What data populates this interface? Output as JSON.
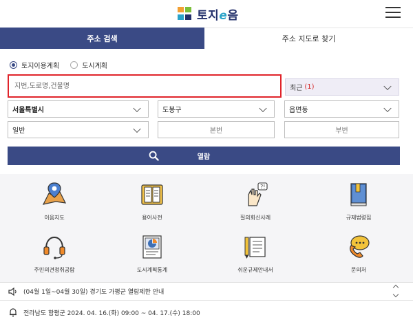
{
  "header": {
    "logo_text": "토지e음",
    "menu_icon": "hamburger-menu-icon"
  },
  "tabs": [
    {
      "label": "주소 검색",
      "active": true
    },
    {
      "label": "주소 지도로 찾기",
      "active": false
    }
  ],
  "search": {
    "radios": [
      {
        "label": "토지이용계획",
        "checked": true
      },
      {
        "label": "도시계획",
        "checked": false
      }
    ],
    "placeholder": "지번,도로명,건물명",
    "value": "",
    "recent_label": "최근",
    "recent_count": "(1)",
    "selects": {
      "sido": "서울특별시",
      "sigungu": "도봉구",
      "eupmyeondong": "읍면동",
      "type": "일반"
    },
    "bonbun_placeholder": "본번",
    "bubun_placeholder": "부번",
    "view_button": "열람"
  },
  "menu": [
    {
      "label": "이음지도",
      "icon": "map-pin-icon"
    },
    {
      "label": "용어사전",
      "icon": "book-icon"
    },
    {
      "label": "질의회신사례",
      "icon": "question-hand-icon"
    },
    {
      "label": "규제법령집",
      "icon": "law-book-icon"
    },
    {
      "label": "주민의견청취공람",
      "icon": "headset-icon"
    },
    {
      "label": "도시계획통계",
      "icon": "statistics-icon"
    },
    {
      "label": "쉬운규제안내서",
      "icon": "guide-pencil-icon"
    },
    {
      "label": "문의처",
      "icon": "phone-chat-icon"
    }
  ],
  "notices": [
    {
      "text": "(04월 1일~04월 30일) 경기도 가평군 열람제한 안내",
      "icon": "speaker-icon"
    },
    {
      "text": "전라남도 함평군 2024. 04. 16.(화) 09:00 ~ 04. 17.(수) 18:00",
      "icon": "bell-icon"
    }
  ],
  "colors": {
    "primary": "#3a4a85",
    "highlight_border": "#e0232a",
    "recent_bg": "#efedf6",
    "recent_count": "#d62b2b",
    "grid_bg": "#f5f5f7"
  }
}
